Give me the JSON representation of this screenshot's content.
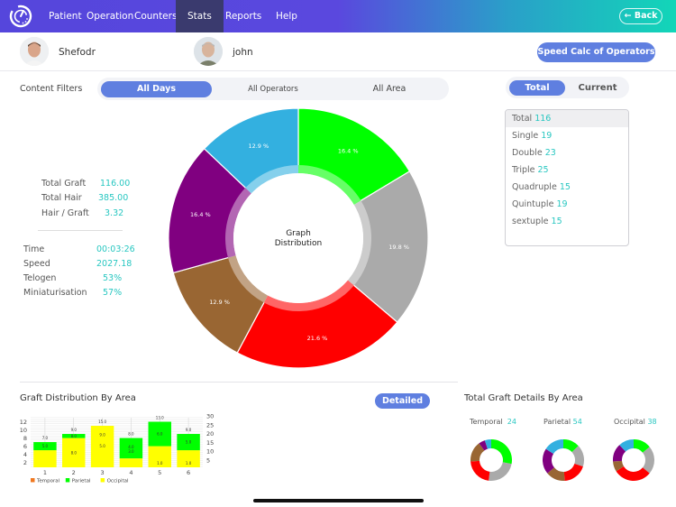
{
  "nav": {
    "logo_icon": "stopwatch-icon",
    "items": [
      {
        "label": "Patient",
        "active": false
      },
      {
        "label": "Operation",
        "active": false
      },
      {
        "label": "Counters",
        "active": false
      },
      {
        "label": "Stats",
        "active": true
      },
      {
        "label": "Reports",
        "active": false
      },
      {
        "label": "Help",
        "active": false
      }
    ],
    "back_label": "← Back"
  },
  "users": [
    {
      "name": "Shefodr"
    },
    {
      "name": "john"
    }
  ],
  "speed_calc_label": "Speed Calc of Operators",
  "filters": {
    "label": "Content Filters",
    "options": [
      {
        "label": "All Days",
        "active": true
      },
      {
        "label": "All Operators",
        "active": false
      },
      {
        "label": "All Area",
        "active": false
      }
    ]
  },
  "mode_toggle": [
    {
      "label": "Total",
      "active": true
    },
    {
      "label": "Current",
      "active": false
    }
  ],
  "graft_types": [
    {
      "label": "Total",
      "value": "116",
      "selected": true
    },
    {
      "label": "Single",
      "value": "19",
      "selected": false
    },
    {
      "label": "Double",
      "value": "23",
      "selected": false
    },
    {
      "label": "Triple",
      "value": "25",
      "selected": false
    },
    {
      "label": "Quadruple",
      "value": "15",
      "selected": false
    },
    {
      "label": "Quintuple",
      "value": "19",
      "selected": false
    },
    {
      "label": "sextuple",
      "value": "15",
      "selected": false
    }
  ],
  "summary": [
    {
      "label": "Total Graft",
      "value": "116.00"
    },
    {
      "label": "Total Hair",
      "value": "385.00"
    },
    {
      "label": "Hair / Graft",
      "value": "3.32"
    }
  ],
  "metrics": [
    {
      "label": "Time",
      "value": "00:03:26"
    },
    {
      "label": "Speed",
      "value": "2027.18"
    },
    {
      "label": "Telogen",
      "value": "53%"
    },
    {
      "label": "Miniaturisation",
      "value": "57%"
    }
  ],
  "bar_section": {
    "title": "Graft Distribution By Area",
    "detailed_label": "Detailed"
  },
  "mini_section": {
    "title": "Total Graft Details By Area",
    "areas": [
      {
        "label": "Temporal",
        "value": "24"
      },
      {
        "label": "Parietal",
        "value": "54"
      },
      {
        "label": "Occipital",
        "value": "38"
      }
    ]
  },
  "chart_data": [
    {
      "type": "pie",
      "variant": "donut",
      "title": "Graph Distribution",
      "center_label": [
        "Graph",
        "Distribution"
      ],
      "slices": [
        {
          "label": "16.4 %",
          "value": 16.4,
          "color": "#00ff00"
        },
        {
          "label": "19.8 %",
          "value": 19.8,
          "color": "#aaaaaa"
        },
        {
          "label": "21.6 %",
          "value": 21.6,
          "color": "#ff0000"
        },
        {
          "label": "12.9 %",
          "value": 12.9,
          "color": "#996633"
        },
        {
          "label": "16.4 %",
          "value": 16.4,
          "color": "#800080"
        },
        {
          "label": "12.9 %",
          "value": 12.9,
          "color": "#33b0e0"
        }
      ]
    },
    {
      "type": "bar",
      "stacked": true,
      "title": "Graft Distribution By Area",
      "categories": [
        "1",
        "2",
        "3",
        "4",
        "5",
        "6"
      ],
      "series": [
        {
          "name": "Temporal",
          "color": "#f07820",
          "values": [
            0,
            0,
            0,
            0,
            0,
            0
          ]
        },
        {
          "name": "Occipital",
          "color": "#ffff00",
          "values": [
            5,
            8,
            11,
            3,
            6,
            5
          ]
        },
        {
          "name": "Parietal",
          "color": "#00ff00",
          "values": [
            2,
            1,
            0,
            5,
            6,
            4
          ]
        }
      ],
      "top_labels": [
        "7.0",
        "9.0",
        "15.0",
        "8.0",
        "13.0",
        "9.0"
      ],
      "inner_labels": [
        [
          "5.0"
        ],
        [
          "8.0",
          "8.0"
        ],
        [
          "9.0",
          "5.0"
        ],
        [
          "4.0",
          "3.0"
        ],
        [
          "6.0",
          "1.0"
        ],
        [
          "5.0",
          "1.0"
        ]
      ],
      "y_left": {
        "ticks": [
          2,
          4,
          6,
          8,
          10,
          12
        ],
        "range": [
          0.8,
          13
        ]
      },
      "y_right": {
        "ticks": [
          5,
          10,
          15,
          20,
          25,
          30
        ]
      },
      "legend": [
        "Temporal",
        "Parietal",
        "Occipital"
      ],
      "legend_position": "bottom-left",
      "grid": true
    },
    {
      "type": "pie",
      "variant": "donut",
      "title": "Temporal",
      "slices": [
        {
          "value": 28,
          "color": "#00ff00"
        },
        {
          "value": 24,
          "color": "#aaaaaa"
        },
        {
          "value": 22,
          "color": "#ff0000"
        },
        {
          "value": 16,
          "color": "#996633"
        },
        {
          "value": 5,
          "color": "#800080"
        },
        {
          "value": 5,
          "color": "#33b0e0"
        }
      ]
    },
    {
      "type": "pie",
      "variant": "donut",
      "title": "Parietal",
      "slices": [
        {
          "value": 13,
          "color": "#00ff00"
        },
        {
          "value": 17,
          "color": "#aaaaaa"
        },
        {
          "value": 19,
          "color": "#ff0000"
        },
        {
          "value": 15,
          "color": "#996633"
        },
        {
          "value": 20,
          "color": "#800080"
        },
        {
          "value": 16,
          "color": "#33b0e0"
        }
      ]
    },
    {
      "type": "pie",
      "variant": "donut",
      "title": "Occipital",
      "slices": [
        {
          "value": 14,
          "color": "#00ff00"
        },
        {
          "value": 22,
          "color": "#aaaaaa"
        },
        {
          "value": 30,
          "color": "#ff0000"
        },
        {
          "value": 8,
          "color": "#996633"
        },
        {
          "value": 14,
          "color": "#800080"
        },
        {
          "value": 12,
          "color": "#33b0e0"
        }
      ]
    }
  ]
}
